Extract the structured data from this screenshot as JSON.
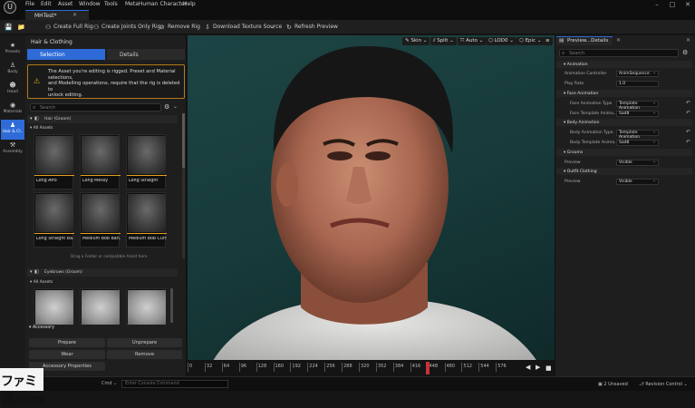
{
  "menu": [
    "File",
    "Edit",
    "Asset",
    "Window",
    "Tools",
    "MetaHuman Character",
    "Help"
  ],
  "doc_tab": "MHTest*",
  "toolbar": {
    "create_full_rig": "Create Full Rig",
    "create_joints_only": "Create Joints Only Rig",
    "remove_rig": "Remove Rig",
    "download_texture": "Download Texture Source",
    "refresh_preview": "Refresh Preview"
  },
  "leftnav": [
    {
      "label": "Presets",
      "icon": "star-icon"
    },
    {
      "label": "Body",
      "icon": "body-icon"
    },
    {
      "label": "Head",
      "icon": "head-icon"
    },
    {
      "label": "Materials",
      "icon": "materials-icon"
    },
    {
      "label": "Hair & Cl..",
      "icon": "hair-icon"
    },
    {
      "label": "Assembly",
      "icon": "hammer-icon"
    }
  ],
  "panel": {
    "title": "Hair & Clothing",
    "tab_selection": "Selection",
    "tab_details": "Details",
    "warning": [
      "The Asset you're editing is rigged. Preset and Material selections,",
      "and Modelling operations, require that the rig is deleted to",
      "unlock editing."
    ],
    "search_placeholder": "Search",
    "hair_header": "Hair (Groom)",
    "all_assets": "All Assets",
    "hair_items": [
      "Long Afro",
      "Long Messy",
      "Long Straight",
      "Long Straight Ba...",
      "Medium Bob Ban...",
      "Medium Bob Curly"
    ],
    "drop_hint": "Drag a Folder or compatible Asset here",
    "eyebrows_header": "Eyebrows (Groom)",
    "all_assets_2": "All Assets",
    "accessory_header": "Accessory",
    "prepare": "Prepare",
    "unprepare": "Unprepare",
    "wear": "Wear",
    "remove": "Remove",
    "accessory_properties": "Accessory Properties"
  },
  "viewport": {
    "skin": "Skin",
    "split": "Split",
    "auto": "Auto",
    "lod": "LOD0",
    "epic": "Epic"
  },
  "timeline_ticks": [
    "0",
    "32",
    "64",
    "96",
    "128",
    "160",
    "192",
    "224",
    "256",
    "288",
    "320",
    "352",
    "384",
    "416",
    "448",
    "480",
    "512",
    "544",
    "576"
  ],
  "details": {
    "tab": "Preview...Details",
    "search_placeholder": "Search",
    "animation_cat": "Animation",
    "anim_controller_label": "Animation Controller",
    "anim_controller_value": "AnimSequence",
    "play_rate_label": "Play Rate",
    "play_rate_value": "1.0",
    "face_anim_cat": "Face Animation",
    "face_anim_type_label": "Face Animation Type",
    "face_anim_type_value": "Template Animation",
    "face_template_label": "Face Template Anima...",
    "face_template_value": "Sad8",
    "body_anim_cat": "Body Animation",
    "body_anim_type_label": "Body Animation Type",
    "body_anim_type_value": "Template Animation",
    "body_template_label": "Body Template Anima...",
    "body_template_value": "Sad8",
    "grooms_cat": "Grooms",
    "grooms_preview_label": "Preview",
    "grooms_preview_value": "Visible",
    "outfit_cat": "Outfit Clothing",
    "outfit_preview_label": "Preview",
    "outfit_preview_value": "Visible"
  },
  "status": {
    "cmd": "Cmd",
    "console_placeholder": "Enter Console Command",
    "unsaved": "2 Unsaved",
    "revision": "Revision Control"
  },
  "watermark": "ファミ通.com",
  "colors": {
    "accent": "#2e6bd8",
    "warning": "#e5a020",
    "playhead": "#c8323c"
  }
}
